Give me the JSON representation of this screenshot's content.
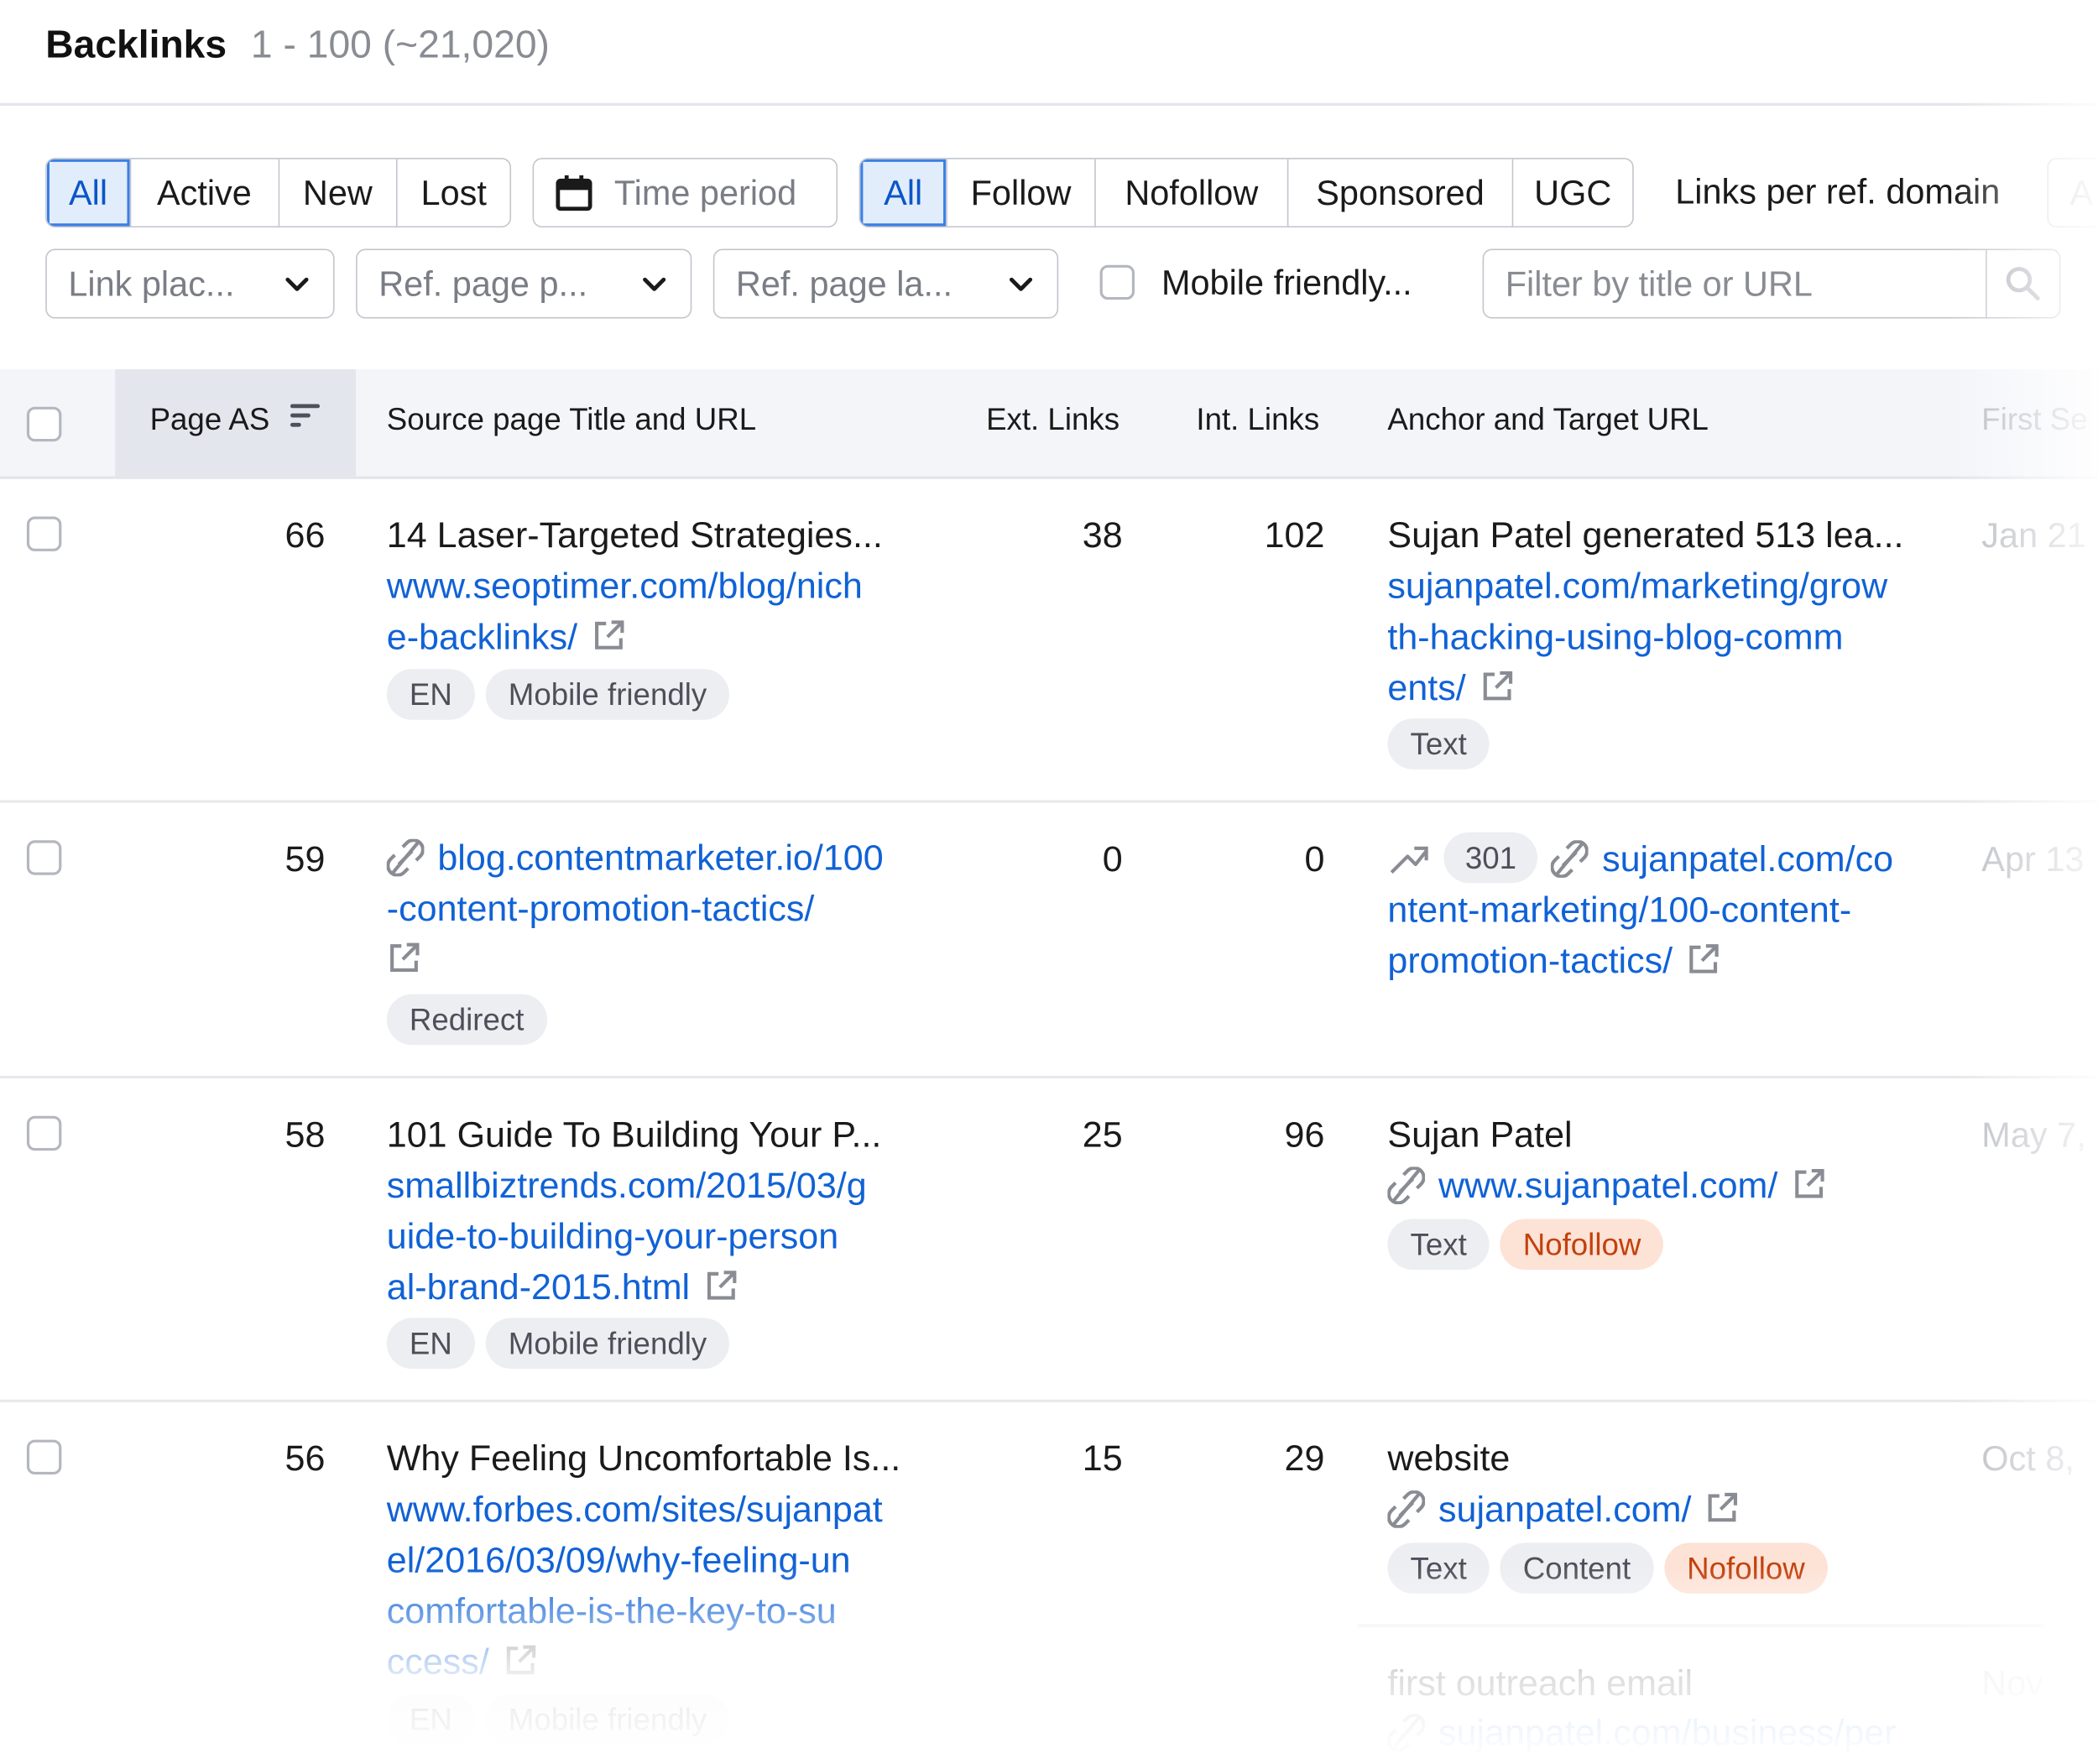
{
  "header": {
    "title": "Backlinks",
    "range": "1 - 100 (~21,020)"
  },
  "status_filter": {
    "items": [
      "All",
      "Active",
      "New",
      "Lost"
    ],
    "selected": "All"
  },
  "time_period": {
    "label": "Time period",
    "icon": "calendar-icon"
  },
  "link_type_filter": {
    "items": [
      "All",
      "Follow",
      "Nofollow",
      "Sponsored",
      "UGC"
    ],
    "selected": "All"
  },
  "links_per_domain": {
    "label": "Links per ref. domain",
    "value": "A"
  },
  "dropdowns": {
    "link_placement": "Link plac...",
    "ref_page_p": "Ref. page p...",
    "ref_page_la": "Ref. page la..."
  },
  "mobile_filter": {
    "label": "Mobile friendly..."
  },
  "search": {
    "placeholder": "Filter by title or URL",
    "icon": "search-icon"
  },
  "columns": {
    "page_as": "Page AS",
    "source": "Source page Title and URL",
    "ext": "Ext. Links",
    "int": "Int. Links",
    "anchor": "Anchor and Target URL",
    "first_seen": "First Se"
  },
  "colors": {
    "link": "#1062d6",
    "selected_bg": "#e2edfc",
    "selected_border": "#3b7fe6",
    "nofollow_bg": "#fde2d6",
    "nofollow_text": "#c2410c"
  },
  "rows": [
    {
      "page_as": "66",
      "source_title": "14 Laser-Targeted Strategies...",
      "source_url": [
        "www.seoptimer.com/blog/nich",
        "e-backlinks/"
      ],
      "source_tags": [
        "EN",
        "Mobile friendly"
      ],
      "ext": "38",
      "int": "102",
      "anchor": "Sujan Patel generated 513 lea...",
      "target_url": [
        "sujanpatel.com/marketing/grow",
        "th-hacking-using-blog-comm",
        "ents/"
      ],
      "target_tags": [
        "Text"
      ],
      "first_seen": "Jan 21"
    },
    {
      "page_as": "59",
      "source_url": [
        "blog.contentmarketer.io/100",
        "-content-promotion-tactics/"
      ],
      "source_tags": [
        "Redirect"
      ],
      "ext": "0",
      "int": "0",
      "redirect_code": "301",
      "target_url": [
        "sujanpatel.com/co",
        "ntent-marketing/100-content-",
        "promotion-tactics/"
      ],
      "first_seen": "Apr 13"
    },
    {
      "page_as": "58",
      "source_title": "101 Guide To Building Your P...",
      "source_url": [
        "smallbiztrends.com/2015/03/g",
        "uide-to-building-your-person",
        "al-brand-2015.html"
      ],
      "source_tags": [
        "EN",
        "Mobile friendly"
      ],
      "ext": "25",
      "int": "96",
      "anchor": "Sujan Patel",
      "target_url": [
        "www.sujanpatel.com/"
      ],
      "target_tags": [
        "Text",
        "Nofollow"
      ],
      "first_seen": "May 7,"
    },
    {
      "page_as": "56",
      "source_title": "Why Feeling Uncomfortable Is...",
      "source_url": [
        "www.forbes.com/sites/sujanpat",
        "el/2016/03/09/why-feeling-un",
        "comfortable-is-the-key-to-su",
        "ccess/"
      ],
      "source_tags": [
        "EN",
        "Mobile friendly"
      ],
      "ext": "15",
      "int": "29",
      "anchor": "website",
      "target_url": [
        "sujanpatel.com/"
      ],
      "target_tags": [
        "Text",
        "Content",
        "Nofollow"
      ],
      "first_seen": "Oct 8,",
      "extra_anchor": "first outreach email",
      "extra_target_url": "sujanpatel.com/business/per",
      "extra_first_seen": "Nov"
    }
  ]
}
